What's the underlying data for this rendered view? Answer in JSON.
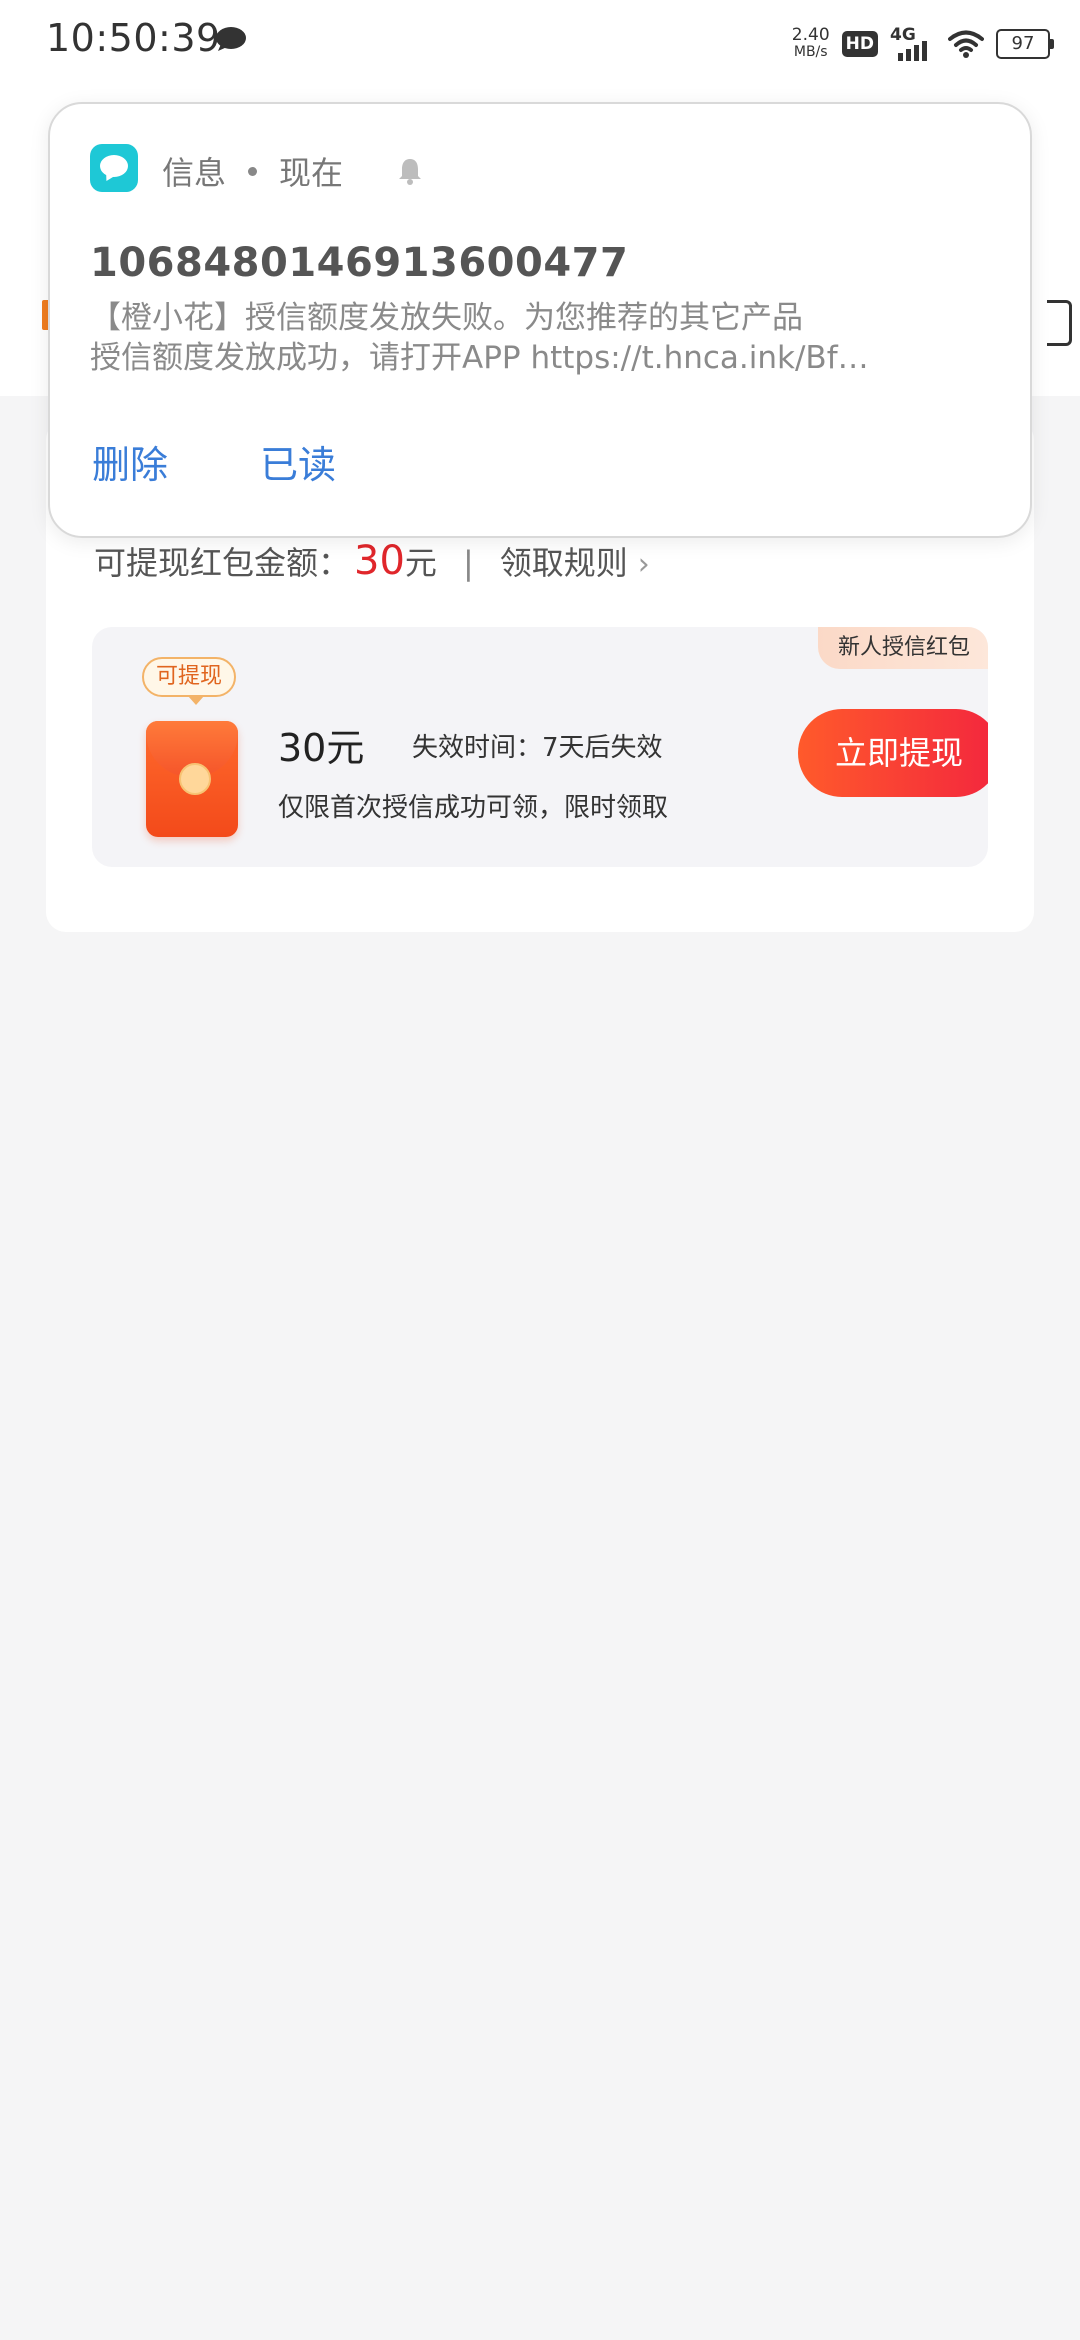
{
  "status_bar": {
    "time": "10:50:39",
    "speed_value": "2.40",
    "speed_unit": "MB/s",
    "hd": "HD",
    "network": "4G",
    "battery": "97"
  },
  "notification": {
    "app_name": "信息",
    "time": "现在",
    "sender": "1068480146913600477",
    "body_line1": "【橙小花】授信额度发放失败。为您推荐的其它产品",
    "body_line2": "授信额度发放成功，请打开APP https://t.hnca.ink/Bf…",
    "actions": {
      "delete": "删除",
      "read": "已读"
    }
  },
  "card": {
    "amount_label": "可提现红包金额：",
    "amount_value": "30",
    "amount_unit": "元",
    "separator": "|",
    "rules_link": "领取规则",
    "coupon": {
      "tag": "新人授信红包",
      "badge": "可提现",
      "amount": "30元",
      "expire": "失效时间：7天后失效",
      "desc": "仅限首次授信成功可领，限时领取",
      "button": "立即提现"
    }
  },
  "colors": {
    "accent_red": "#e0262b",
    "button_gradient_start": "#ff5a2b",
    "button_gradient_end": "#f3263e",
    "action_blue": "#3a7dd8",
    "app_icon": "#1ec8d6"
  }
}
